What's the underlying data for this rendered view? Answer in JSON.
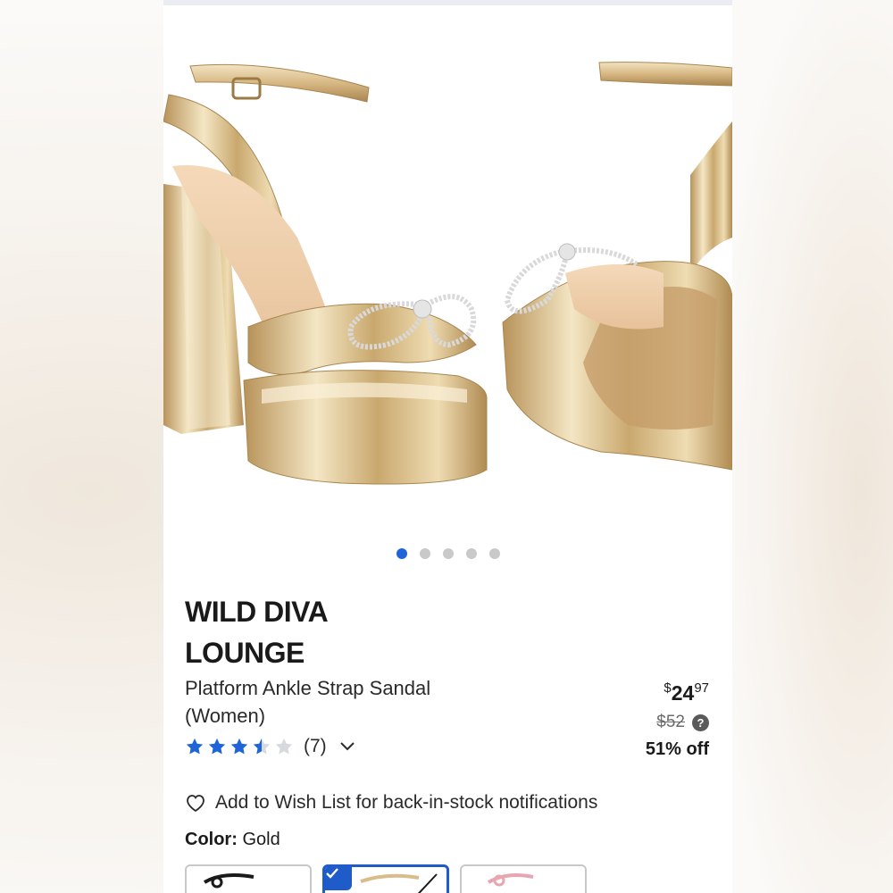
{
  "product": {
    "brand_line1": "WILD DIVA",
    "brand_line2": "LOUNGE",
    "name_line1": "Platform Ankle Strap Sandal",
    "name_line2": "(Women)",
    "rating": 3.5,
    "rating_count": "(7)",
    "price": {
      "currency": "$",
      "dollars": "24",
      "cents": "97",
      "original": "$52",
      "discount": "51% off"
    }
  },
  "gallery": {
    "image_count": 5,
    "active_index": 0
  },
  "wishlist": {
    "label": "Add to Wish List for back-in-stock notifications"
  },
  "color": {
    "label": "Color:",
    "value": "Gold",
    "swatches": [
      "black",
      "gold",
      "pink"
    ],
    "selected": "gold"
  },
  "colors": {
    "accent": "#1f64d8",
    "star": "#1f64d8",
    "gold": "#d8bd8a"
  }
}
